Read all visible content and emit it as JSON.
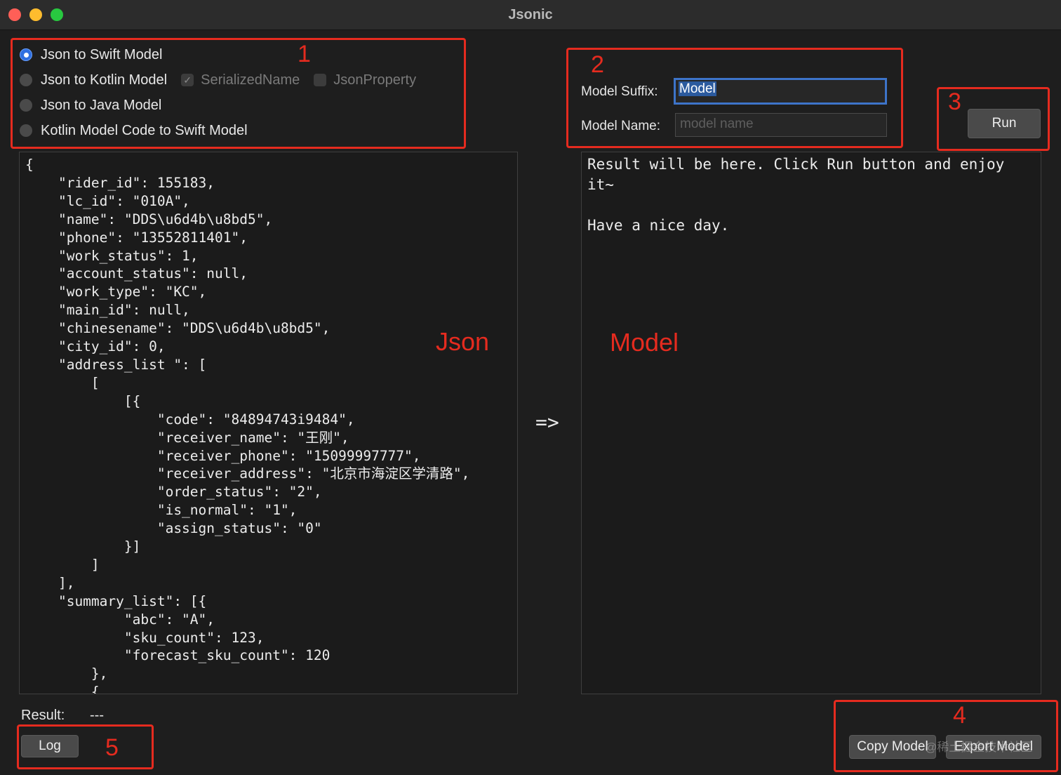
{
  "window": {
    "title": "Jsonic"
  },
  "modes": {
    "options": [
      {
        "label": "Json to Swift Model",
        "selected": true
      },
      {
        "label": "Json to Kotlin Model",
        "selected": false
      },
      {
        "label": "Json to Java Model",
        "selected": false
      },
      {
        "label": "Kotlin Model Code to Swift Model",
        "selected": false
      }
    ],
    "kotlin_options": [
      {
        "label": "SerializedName",
        "checked": true,
        "enabled": false
      },
      {
        "label": "JsonProperty",
        "checked": false,
        "enabled": false
      }
    ]
  },
  "settings": {
    "suffix_label": "Model Suffix:",
    "suffix_value": "Model",
    "name_label": "Model Name:",
    "name_placeholder": "model name"
  },
  "actions": {
    "run_label": "Run",
    "log_label": "Log",
    "copy_label": "Copy Model",
    "export_label": "Export Model"
  },
  "json_input": "{\n    \"rider_id\": 155183,\n    \"lc_id\": \"010A\",\n    \"name\": \"DDS\\u6d4b\\u8bd5\",\n    \"phone\": \"13552811401\",\n    \"work_status\": 1,\n    \"account_status\": null,\n    \"work_type\": \"KC\",\n    \"main_id\": null,\n    \"chinesename\": \"DDS\\u6d4b\\u8bd5\",\n    \"city_id\": 0,\n    \"address_list \": [\n        [\n            [{\n                \"code\": \"84894743i9484\",\n                \"receiver_name\": \"王刚\",\n                \"receiver_phone\": \"15099997777\",\n                \"receiver_address\": \"北京市海淀区学清路\",\n                \"order_status\": \"2\",\n                \"is_normal\": \"1\",\n                \"assign_status\": \"0\"\n            }]\n        ]\n    ],\n    \"summary_list\": [{\n            \"abc\": \"A\",\n            \"sku_count\": 123,\n            \"forecast_sku_count\": 120\n        },\n        {",
  "model_output": "Result will be here. Click Run button and enjoy\nit~\n\nHave a nice day.",
  "arrow": "=>",
  "status": {
    "label": "Result:",
    "value": "---"
  },
  "annotations": {
    "color": "#e52b1f",
    "numbers": [
      "1",
      "2",
      "3",
      "4",
      "5"
    ],
    "json_label": "Json",
    "model_label": "Model"
  },
  "watermark": "@稀土掘金技术社区"
}
